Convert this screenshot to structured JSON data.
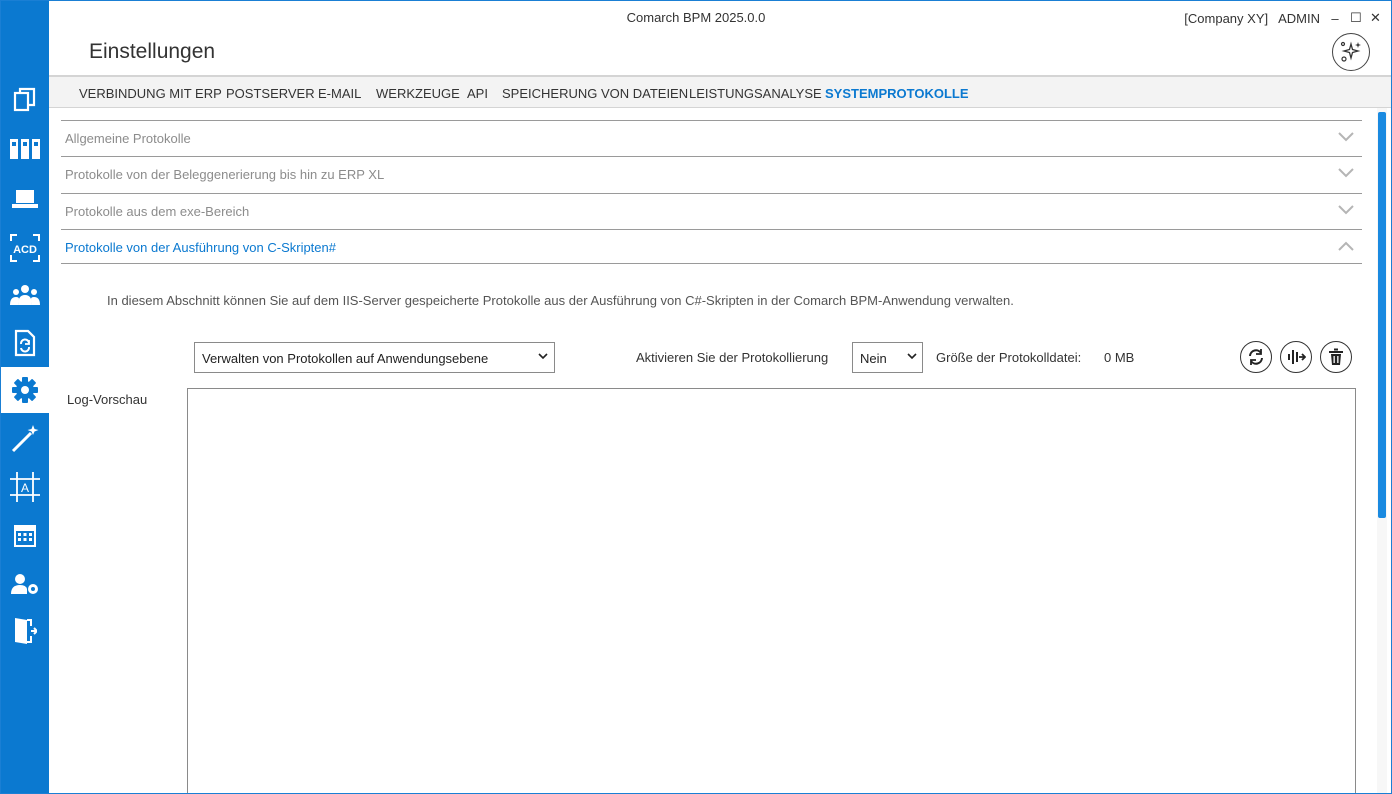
{
  "window": {
    "app_title": "Comarch BPM 2025.0.0",
    "company": "[Company XY]",
    "user": "ADMIN",
    "minimize": "–",
    "maximize": "☐",
    "close": "✕"
  },
  "page": {
    "title": "Einstellungen"
  },
  "sidebar": {
    "accent": "#0b79d0",
    "items": [
      {
        "icon": "documents-icon"
      },
      {
        "icon": "binders-icon"
      },
      {
        "icon": "laptop-icon"
      },
      {
        "icon": "acd-icon"
      },
      {
        "icon": "users-group-icon"
      },
      {
        "icon": "document-sync-icon"
      },
      {
        "icon": "gear-icon",
        "active": true
      },
      {
        "icon": "magic-wand-icon"
      },
      {
        "icon": "text-frame-icon"
      },
      {
        "icon": "calendar-icon"
      },
      {
        "icon": "user-settings-icon"
      },
      {
        "icon": "logout-icon"
      }
    ]
  },
  "tabs": [
    {
      "label": "VERBINDUNG MIT ERP"
    },
    {
      "label": "POSTSERVER"
    },
    {
      "label": "E-MAIL"
    },
    {
      "label": "WERKZEUGE"
    },
    {
      "label": "API"
    },
    {
      "label": "SPEICHERUNG VON DATEIEN"
    },
    {
      "label": "LEISTUNGSANALYSE"
    },
    {
      "label": "SYSTEMPROTOKOLLE",
      "active": true
    }
  ],
  "sections": [
    {
      "label": "Allgemeine Protokolle",
      "expanded": false
    },
    {
      "label": "Protokolle von der Beleggenerierung bis hin zu ERP XL",
      "expanded": false
    },
    {
      "label": "Protokolle aus dem exe-Bereich",
      "expanded": false
    },
    {
      "label": "Protokolle von der Ausführung von C-Skripten#",
      "expanded": true
    }
  ],
  "csharp_section": {
    "description": "In diesem Abschnitt können Sie auf dem IIS-Server gespeicherte Protokolle aus der Ausführung von C#-Skripten in der Comarch BPM-Anwendung verwalten.",
    "level_select_value": "Verwalten von Protokollen auf Anwendungsebene",
    "activate_label": "Aktivieren Sie der Protokollierung",
    "activate_value": "Nein",
    "size_label": "Größe der Protokolldatei:",
    "size_value": "0 MB",
    "log_preview_label": "Log-Vorschau",
    "log_preview_content": "",
    "actions": [
      {
        "icon": "refresh-icon"
      },
      {
        "icon": "download-log-icon"
      },
      {
        "icon": "trash-icon"
      }
    ]
  }
}
